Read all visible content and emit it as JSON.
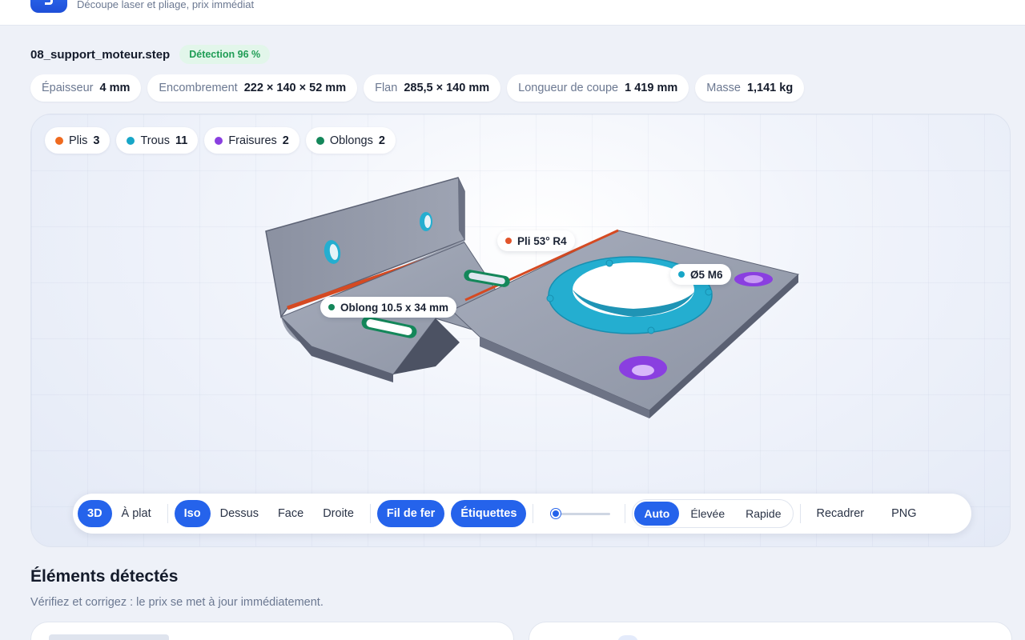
{
  "header": {
    "tagline": "Découpe laser et pliage, prix immédiat"
  },
  "file": {
    "name": "08_support_moteur.step",
    "detection": "Détection 96 %"
  },
  "specs": [
    {
      "label": "Épaisseur",
      "value": "4 mm"
    },
    {
      "label": "Encombrement",
      "value": "222 × 140 × 52 mm"
    },
    {
      "label": "Flan",
      "value": "285,5 × 140 mm"
    },
    {
      "label": "Longueur de coupe",
      "value": "1 419 mm"
    },
    {
      "label": "Masse",
      "value": "1,141 kg"
    }
  ],
  "features": [
    {
      "label": "Plis",
      "count": "3",
      "color": "#ef6a1f"
    },
    {
      "label": "Trous",
      "count": "11",
      "color": "#17a6c7"
    },
    {
      "label": "Fraisures",
      "count": "2",
      "color": "#8a3fe0"
    },
    {
      "label": "Oblongs",
      "count": "2",
      "color": "#14875a"
    }
  ],
  "annotations": {
    "bend": {
      "text": "Pli 53° R4",
      "color": "#e2552b"
    },
    "hole": {
      "text": "Ø5 M6",
      "color": "#17a6c7"
    },
    "slot": {
      "text": "Oblong 10.5 x 34 mm",
      "color": "#14875a"
    }
  },
  "toolbar": {
    "mode_3d": "3D",
    "mode_flat": "À plat",
    "view_iso": "Iso",
    "view_top": "Dessus",
    "view_front": "Face",
    "view_right": "Droite",
    "wireframe": "Fil de fer",
    "labels": "Étiquettes",
    "quality_auto": "Auto",
    "quality_high": "Élevée",
    "quality_fast": "Rapide",
    "recenter": "Recadrer",
    "png": "PNG",
    "slider_value": 0
  },
  "detected": {
    "title": "Éléments détectés",
    "subtitle": "Vérifiez et corrigez : le prix se met à jour immédiatement."
  },
  "colors": {
    "accent": "#2563eb",
    "success": "#1f9d55"
  }
}
